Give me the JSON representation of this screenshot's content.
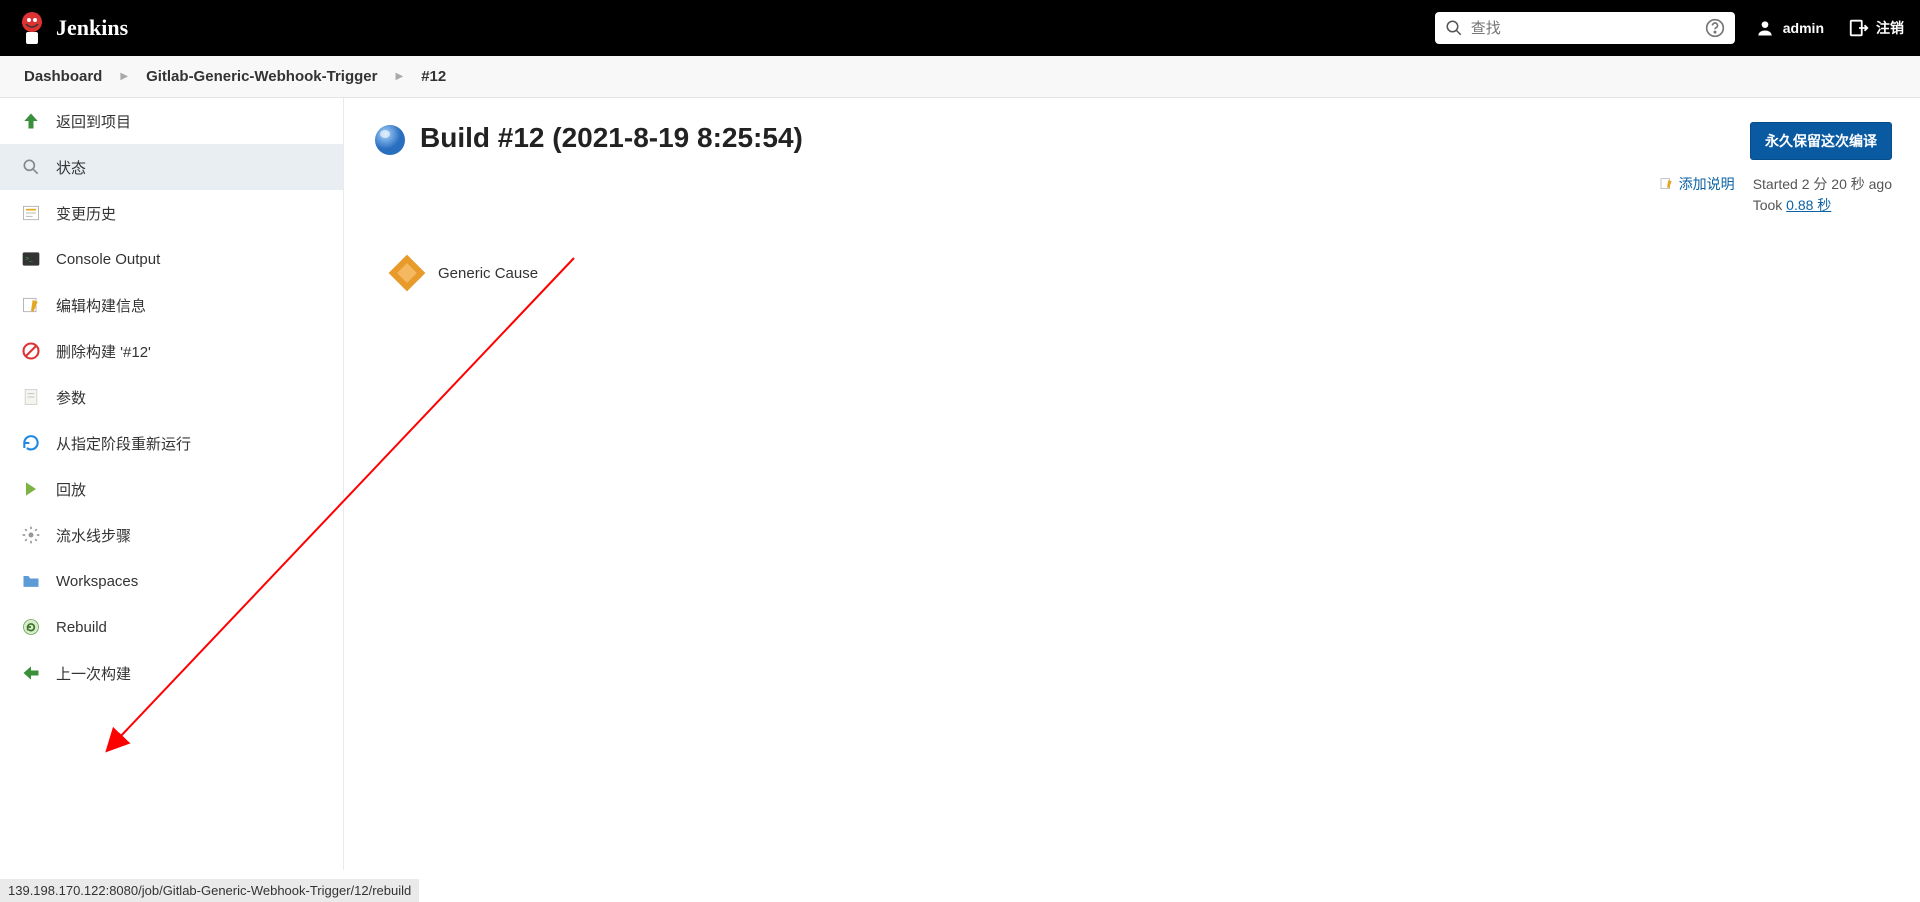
{
  "header": {
    "brand": "Jenkins",
    "search_placeholder": "查找",
    "user": "admin",
    "logout": "注销"
  },
  "breadcrumb": {
    "items": [
      "Dashboard",
      "Gitlab-Generic-Webhook-Trigger",
      "#12"
    ]
  },
  "sidebar": {
    "items": [
      {
        "label": "返回到项目",
        "icon": "arrow-up"
      },
      {
        "label": "状态",
        "icon": "magnifier",
        "active": true
      },
      {
        "label": "变更历史",
        "icon": "history"
      },
      {
        "label": "Console Output",
        "icon": "console"
      },
      {
        "label": "编辑构建信息",
        "icon": "edit"
      },
      {
        "label": "删除构建 '#12'",
        "icon": "delete"
      },
      {
        "label": "参数",
        "icon": "document"
      },
      {
        "label": "从指定阶段重新运行",
        "icon": "refresh"
      },
      {
        "label": "回放",
        "icon": "replay"
      },
      {
        "label": "流水线步骤",
        "icon": "gear"
      },
      {
        "label": "Workspaces",
        "icon": "folder"
      },
      {
        "label": "Rebuild",
        "icon": "rebuild"
      },
      {
        "label": "上一次构建",
        "icon": "arrow-left"
      }
    ]
  },
  "build": {
    "title": "Build #12 (2021-8-19 8:25:54)",
    "keep_button": "永久保留这次编译",
    "add_desc": "添加说明",
    "started": "Started 2 分 20 秒 ago",
    "took_prefix": "Took ",
    "duration": "0.88 秒",
    "cause": "Generic Cause"
  },
  "statusbar": "139.198.170.122:8080/job/Gitlab-Generic-Webhook-Trigger/12/rebuild"
}
